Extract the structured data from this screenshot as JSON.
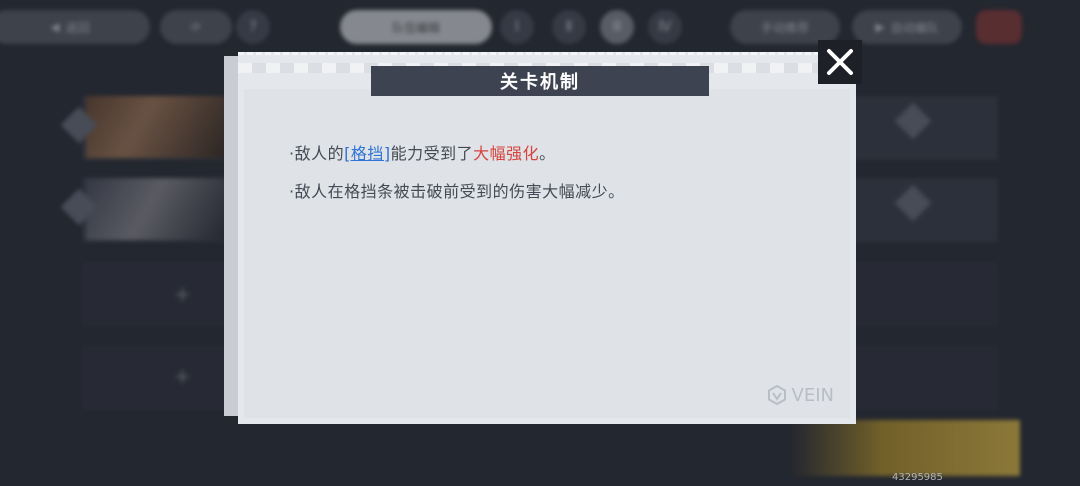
{
  "dialog": {
    "title": "关卡机制",
    "lines": [
      {
        "bullet": "·",
        "pre": "敌人的",
        "keyword": "[格挡]",
        "mid": "能力受到了",
        "highlight": "大幅强化",
        "post": "。"
      },
      {
        "bullet": "·",
        "text": "敌人在格挡条被击破前受到的伤害大幅减少。"
      }
    ],
    "logo_text": "VEIN",
    "close_icon": "close-icon"
  },
  "background": {
    "top_buttons": {
      "back": "返回",
      "preset": "队伍编辑",
      "question": "?",
      "teach": "手动推荐",
      "auto": "自动编队"
    },
    "add_slot": "+"
  },
  "footer": {
    "uid": "43295985"
  },
  "colors": {
    "keyword": "#2f73d6",
    "highlight": "#d6443d",
    "title_bar": "#3e4351",
    "dialog_bg": "#e4e7eb"
  }
}
